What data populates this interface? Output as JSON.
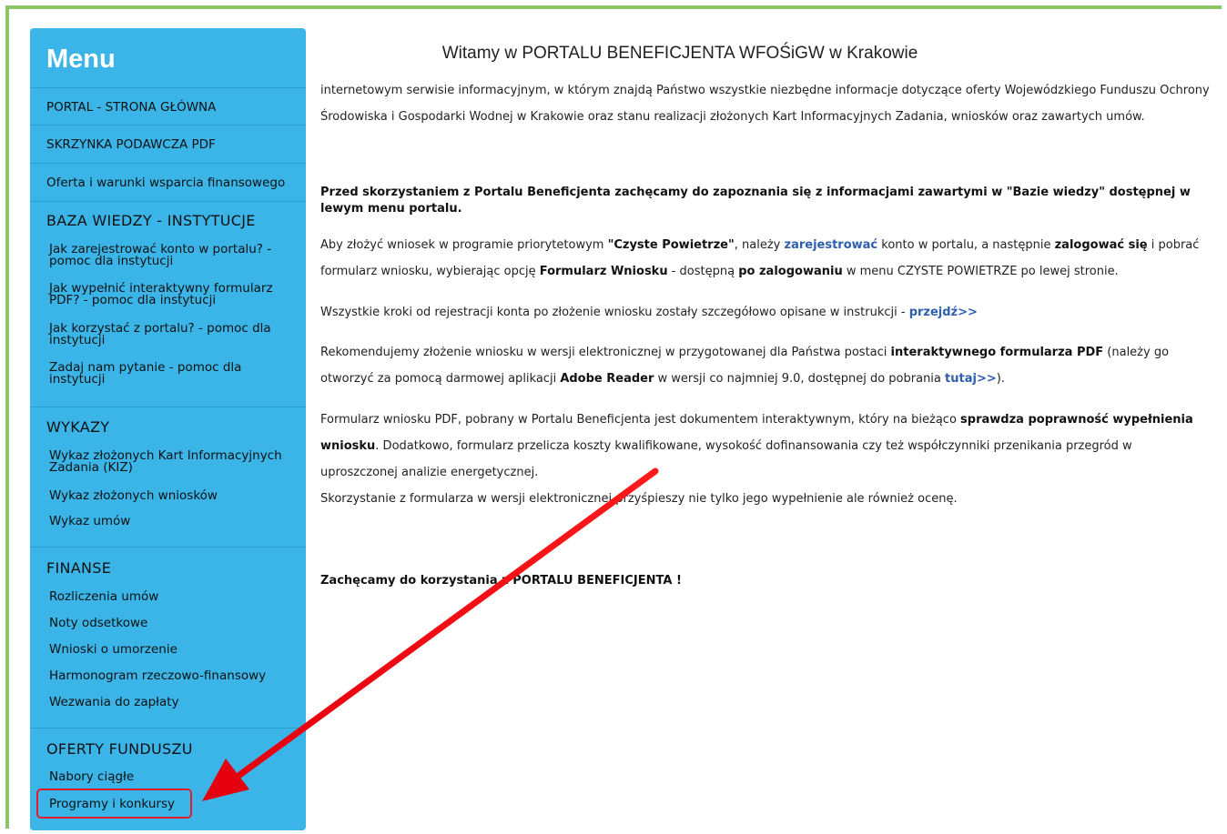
{
  "sidebar": {
    "title": "Menu",
    "top_links": [
      "PORTAL - STRONA GŁÓWNA",
      "SKRZYNKA PODAWCZA PDF",
      "Oferta i warunki wsparcia finansowego"
    ],
    "sections": [
      {
        "title": "BAZA WIEDZY - INSTYTUCJE",
        "items": [
          "Jak zarejestrować konto w portalu? - pomoc dla instytucji",
          "Jak wypełnić interaktywny formularz PDF? - pomoc dla instytucji",
          "Jak korzystać z portalu? - pomoc dla instytucji",
          "Zadaj nam pytanie - pomoc dla instytucji"
        ]
      },
      {
        "title": "WYKAZY",
        "items": [
          "Wykaz złożonych Kart Informacyjnych Zadania (KIZ)",
          "Wykaz złożonych wniosków",
          "Wykaz umów"
        ]
      },
      {
        "title": "FINANSE",
        "items": [
          "Rozliczenia umów",
          "Noty odsetkowe",
          "Wnioski o umorzenie",
          "Harmonogram rzeczowo-finansowy",
          "Wezwania do zapłaty"
        ]
      },
      {
        "title": "OFERTY FUNDUSZU",
        "items": [
          "Nabory ciągłe",
          "Programy i konkursy"
        ]
      }
    ]
  },
  "main": {
    "title": "Witamy w PORTALU BENEFICJENTA WFOŚiGW w Krakowie",
    "intro": "internetowym serwisie informacyjnym, w którym znajdą Państwo wszystkie niezbędne informacje dotyczące oferty Wojewódzkiego Funduszu Ochrony Środowiska i Gospodarki Wodnej w Krakowie oraz stanu realizacji złożonych Kart Informacyjnych Zadania, wniosków oraz zawartych umów.",
    "notice": "Przed skorzystaniem z Portalu Beneficjenta zachęcamy do zapoznania się z informacjami zawartymi w \"Bazie wiedzy\"  dostępnej w lewym menu portalu.",
    "p3": {
      "a": "Aby złożyć wniosek w programie priorytetowym ",
      "b": "\"Czyste Powietrze\"",
      "c": ", należy ",
      "d": "zarejestrować",
      "e": " konto w portalu, a następnie ",
      "f": "zalogować się",
      "g": " i pobrać formularz wniosku, wybierając opcję ",
      "h": "Formularz Wniosku",
      "i": " - dostępną ",
      "j": "po zalogowaniu",
      "k": " w menu CZYSTE POWIETRZE po lewej stronie."
    },
    "p4": {
      "a": "Wszystkie kroki od rejestracji konta po złożenie wniosku zostały szczegółowo opisane w instrukcji - ",
      "link": "przejdź>>"
    },
    "p5": {
      "a": "Rekomendujemy złożenie wniosku w wersji elektronicznej w przygotowanej dla Państwa postaci ",
      "b": "interaktywnego formularza PDF",
      "c": " (należy go otworzyć za pomocą darmowej aplikacji ",
      "d": "Adobe Reader",
      "e": " w wersji co najmniej 9.0, dostępnej do pobrania ",
      "link": "tutaj>>",
      "f": ")."
    },
    "p6": {
      "a": "Formularz wniosku PDF, pobrany w Portalu Beneficjenta jest dokumentem interaktywnym, który na bieżąco ",
      "b": "sprawdza poprawność wypełnienia wniosku",
      "c": ". Dodatkowo, formularz przelicza koszty kwalifikowane, wysokość dofinansowania czy też współczynniki przenikania przegród w uproszczonej analizie energetycznej.",
      "d": "Skorzystanie z formularza w wersji elektronicznej przyśpieszy nie tylko jego wypełnienie ale również ocenę."
    },
    "closing": "Zachęcamy do korzystania z PORTALU BENEFICJENTA !"
  },
  "colors": {
    "sidebar": "#3bb5e8",
    "frame": "#8cc567",
    "link": "#2d5fae",
    "highlight": "#e11d2b"
  }
}
